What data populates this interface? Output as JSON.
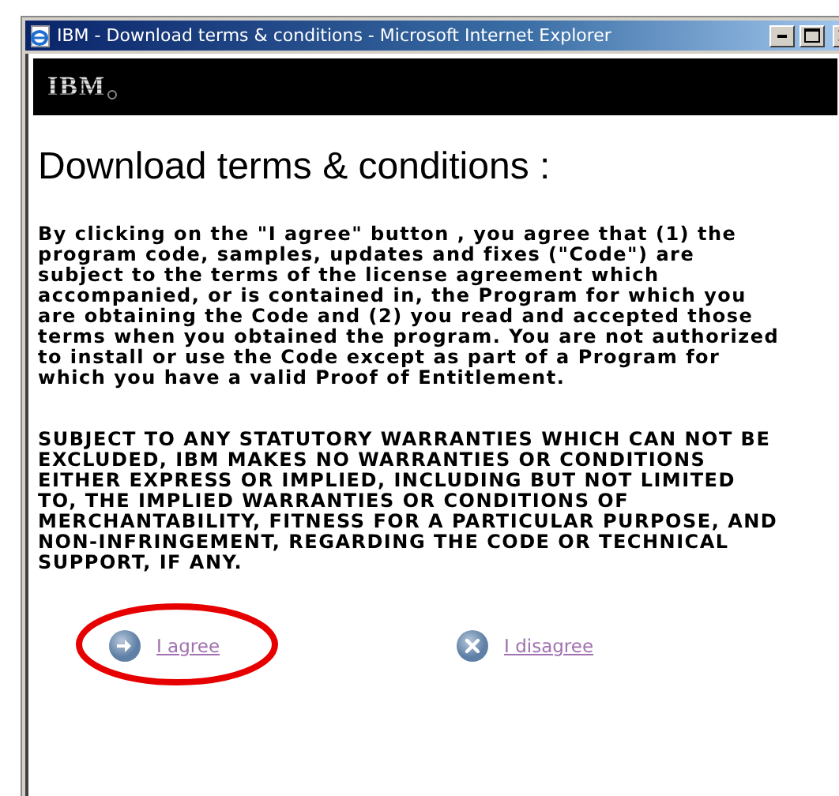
{
  "window": {
    "title": "IBM - Download terms & conditions - Microsoft Internet Explorer"
  },
  "banner": {
    "logo": "IBM"
  },
  "heading": "Download terms & conditions :",
  "paragraphs": [
    "By clicking on the \"I agree\" button , you agree that (1) the program code, samples, updates and fixes (\"Code\") are subject to the terms of the license agreement which accompanied, or is contained in, the Program for which you are obtaining the Code and (2) you read and accepted those terms when you obtained the program. You are not authorized to install or use the Code except as part of a Program for which you have a valid Proof of Entitlement.",
    "SUBJECT TO ANY STATUTORY WARRANTIES WHICH CAN NOT BE EXCLUDED, IBM MAKES NO WARRANTIES OR CONDITIONS EITHER EXPRESS OR IMPLIED, INCLUDING BUT NOT LIMITED TO, THE IMPLIED WARRANTIES OR CONDITIONS OF MERCHANTABILITY, FITNESS FOR A PARTICULAR PURPOSE, AND NON-INFRINGEMENT, REGARDING THE CODE OR TECHNICAL SUPPORT, IF ANY."
  ],
  "actions": [
    {
      "kind": "agree",
      "label": "I agree",
      "highlighted": true
    },
    {
      "kind": "disagree",
      "label": "I disagree",
      "highlighted": false
    }
  ]
}
